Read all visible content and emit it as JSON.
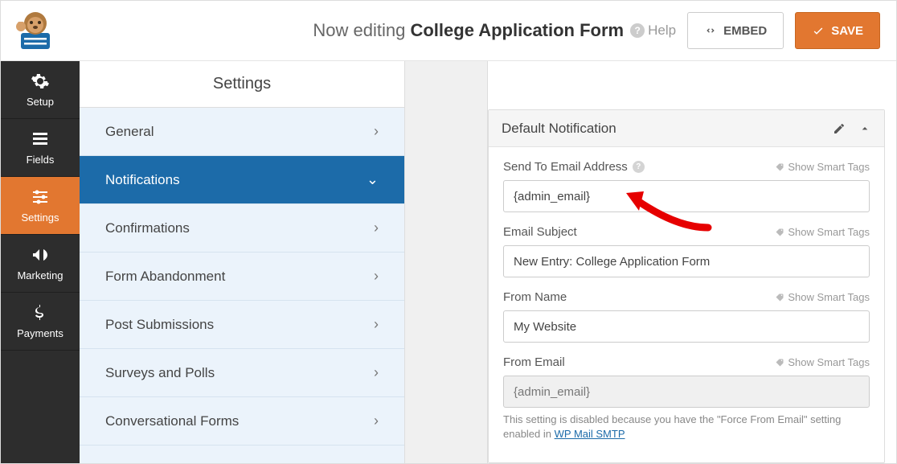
{
  "header": {
    "editing_prefix": "Now editing ",
    "form_name": "College Application Form",
    "help_label": "Help",
    "embed_label": "EMBED",
    "save_label": "SAVE"
  },
  "nav": {
    "items": [
      {
        "label": "Setup"
      },
      {
        "label": "Fields"
      },
      {
        "label": "Settings"
      },
      {
        "label": "Marketing"
      },
      {
        "label": "Payments"
      }
    ],
    "active_index": 2
  },
  "subside": {
    "title": "Settings",
    "items": [
      {
        "label": "General"
      },
      {
        "label": "Notifications"
      },
      {
        "label": "Confirmations"
      },
      {
        "label": "Form Abandonment"
      },
      {
        "label": "Post Submissions"
      },
      {
        "label": "Surveys and Polls"
      },
      {
        "label": "Conversational Forms"
      }
    ],
    "active_index": 1
  },
  "panel": {
    "title": "Default Notification",
    "smart_tag_label": "Show Smart Tags",
    "fields": {
      "send_to": {
        "label": "Send To Email Address",
        "value": "{admin_email}"
      },
      "subject": {
        "label": "Email Subject",
        "value": "New Entry: College Application Form"
      },
      "from_name": {
        "label": "From Name",
        "value": "My Website"
      },
      "from_email": {
        "label": "From Email",
        "value": "{admin_email}",
        "note_prefix": "This setting is disabled because you have the \"Force From Email\" setting enabled in ",
        "note_link": "WP Mail SMTP"
      }
    }
  }
}
